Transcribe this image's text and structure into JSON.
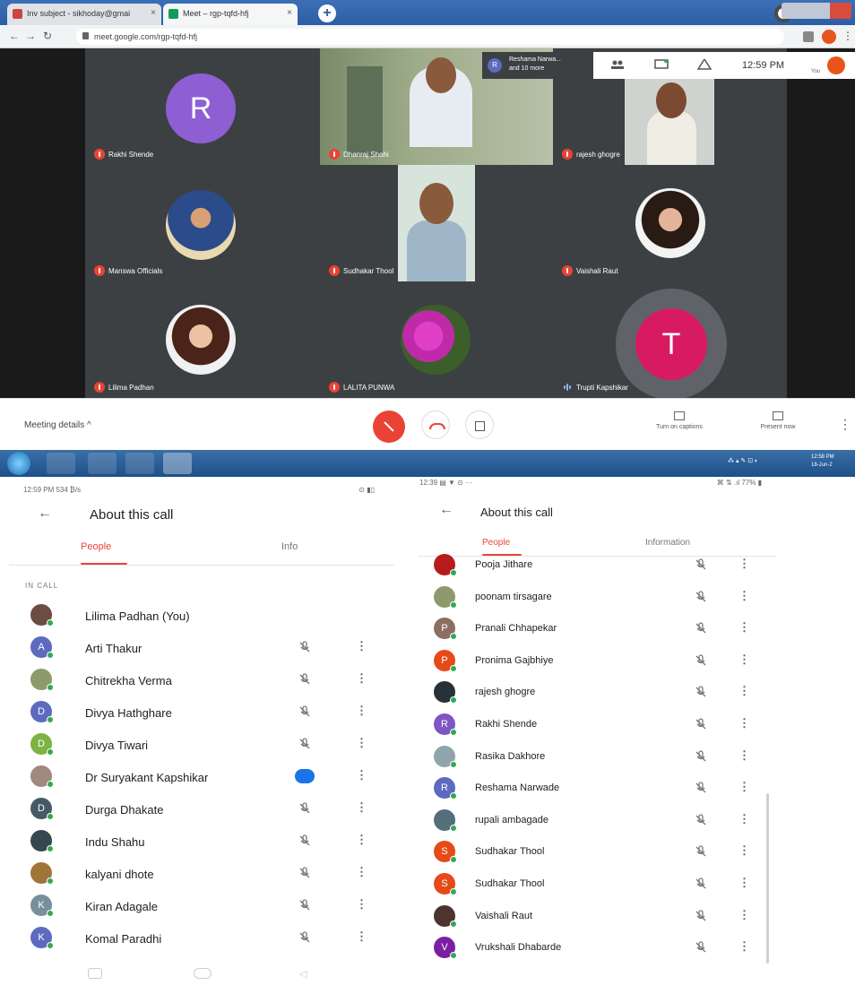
{
  "browser": {
    "tabs": [
      {
        "label": "Inv subject - sikhoday@gmai"
      },
      {
        "label": "Meet – rgp-tqfd-hfj"
      }
    ],
    "url": "meet.google.com/rgp-tqfd-hfj",
    "new_tab_symbol": "+",
    "tab_close_symbol": "×"
  },
  "meet": {
    "presenting_initial": "R",
    "presenting_text_line1": "Reshama Narwa...",
    "presenting_text_line2": "and 10 more",
    "clock": "12:59 PM",
    "you_label": "You",
    "tiles": [
      {
        "name": "Rakhi Shende",
        "type": "letter",
        "letter": "R",
        "color": "#8e5fd3",
        "mic": "off"
      },
      {
        "name": "Dhanraj Shahi",
        "type": "video",
        "mic": "off"
      },
      {
        "name": "rajesh ghogre",
        "type": "video",
        "mic": "off"
      },
      {
        "name": "Manswa Officials",
        "type": "photo",
        "mic": "off"
      },
      {
        "name": "Sudhakar Thool",
        "type": "video",
        "mic": "off"
      },
      {
        "name": "Vaishali Raut",
        "type": "photo",
        "mic": "off"
      },
      {
        "name": "Lilima Padhan",
        "type": "photo",
        "mic": "off"
      },
      {
        "name": "LALITA PUNWA",
        "type": "photo",
        "mic": "off"
      },
      {
        "name": "Trupti Kapshikar",
        "type": "letter",
        "letter": "T",
        "color": "#d81b60",
        "mic": "active"
      }
    ],
    "controls": {
      "meeting_details": "Meeting details ^",
      "captions_label": "Turn on captions",
      "present_label": "Present now",
      "more_symbol": "⋮"
    }
  },
  "taskbar": {
    "tray_text": "⁂ ▴ ✎ ⊡ ◐",
    "clock_line1": "12:58 PM",
    "clock_line2": "18-Jun-2"
  },
  "left_pane": {
    "status_left": "12:59 PM 534 ₿/s",
    "status_right": "⊙ ▮▯",
    "title": "About this call",
    "tabs": [
      "People",
      "Info"
    ],
    "section": "IN CALL",
    "people": [
      {
        "name": "Lilima Padhan (You)",
        "avatar": "photo",
        "color": "#6d4c41",
        "mic": "none"
      },
      {
        "name": "Arti Thakur",
        "avatar": "letter",
        "letter": "A",
        "color": "#5c6bc0",
        "mic": "muted"
      },
      {
        "name": "Chitrekha Verma",
        "avatar": "photo",
        "color": "#8d9a6b",
        "mic": "muted"
      },
      {
        "name": "Divya Hathghare",
        "avatar": "letter",
        "letter": "D",
        "color": "#5c6bc0",
        "mic": "muted"
      },
      {
        "name": "Divya Tiwari",
        "avatar": "letter",
        "letter": "D",
        "color": "#7cb342",
        "mic": "muted"
      },
      {
        "name": "Dr Suryakant Kapshikar",
        "avatar": "photo",
        "color": "#a1887f",
        "mic": "speaking"
      },
      {
        "name": "Durga Dhakate",
        "avatar": "letter",
        "letter": "D",
        "color": "#455a64",
        "mic": "muted"
      },
      {
        "name": "Indu Shahu",
        "avatar": "photo",
        "color": "#37474f",
        "mic": "muted"
      },
      {
        "name": "kalyani dhote",
        "avatar": "photo",
        "color": "#a1743a",
        "mic": "muted"
      },
      {
        "name": "Kiran Adagale",
        "avatar": "letter",
        "letter": "K",
        "color": "#78909c",
        "mic": "muted"
      },
      {
        "name": "Komal Paradhi",
        "avatar": "letter",
        "letter": "K",
        "color": "#5c6bc0",
        "mic": "muted"
      }
    ]
  },
  "right_pane": {
    "status_left": "12:39 ▤ ▼ ⊙ ···",
    "status_right": "⌘ ⇅ .ıl 77% ▮",
    "title": "About this call",
    "tabs": [
      "People",
      "Information"
    ],
    "people": [
      {
        "name": "Pooja Jithare",
        "avatar": "photo",
        "color": "#b71c1c"
      },
      {
        "name": "poonam tirsagare",
        "avatar": "photo",
        "color": "#8d9a6b"
      },
      {
        "name": "Pranali Chhapekar",
        "avatar": "letter",
        "letter": "P",
        "color": "#8d6e63"
      },
      {
        "name": "Pronima Gajbhiye",
        "avatar": "letter",
        "letter": "P",
        "color": "#e64a19"
      },
      {
        "name": "rajesh ghogre",
        "avatar": "photo",
        "color": "#263238"
      },
      {
        "name": "Rakhi Shende",
        "avatar": "letter",
        "letter": "R",
        "color": "#7e57c2"
      },
      {
        "name": "Rasika Dakhore",
        "avatar": "photo",
        "color": "#90a4ae"
      },
      {
        "name": "Reshama Narwade",
        "avatar": "letter",
        "letter": "R",
        "color": "#5c6bc0"
      },
      {
        "name": "rupali ambagade",
        "avatar": "photo",
        "color": "#546e7a"
      },
      {
        "name": "Sudhakar Thool",
        "avatar": "letter",
        "letter": "S",
        "color": "#e64a19"
      },
      {
        "name": "Sudhakar Thool",
        "avatar": "letter",
        "letter": "S",
        "color": "#e64a19"
      },
      {
        "name": "Vaishali Raut",
        "avatar": "photo",
        "color": "#4e342e"
      },
      {
        "name": "Vrukshali Dhabarde",
        "avatar": "letter",
        "letter": "V",
        "color": "#7b1fa2"
      }
    ]
  }
}
